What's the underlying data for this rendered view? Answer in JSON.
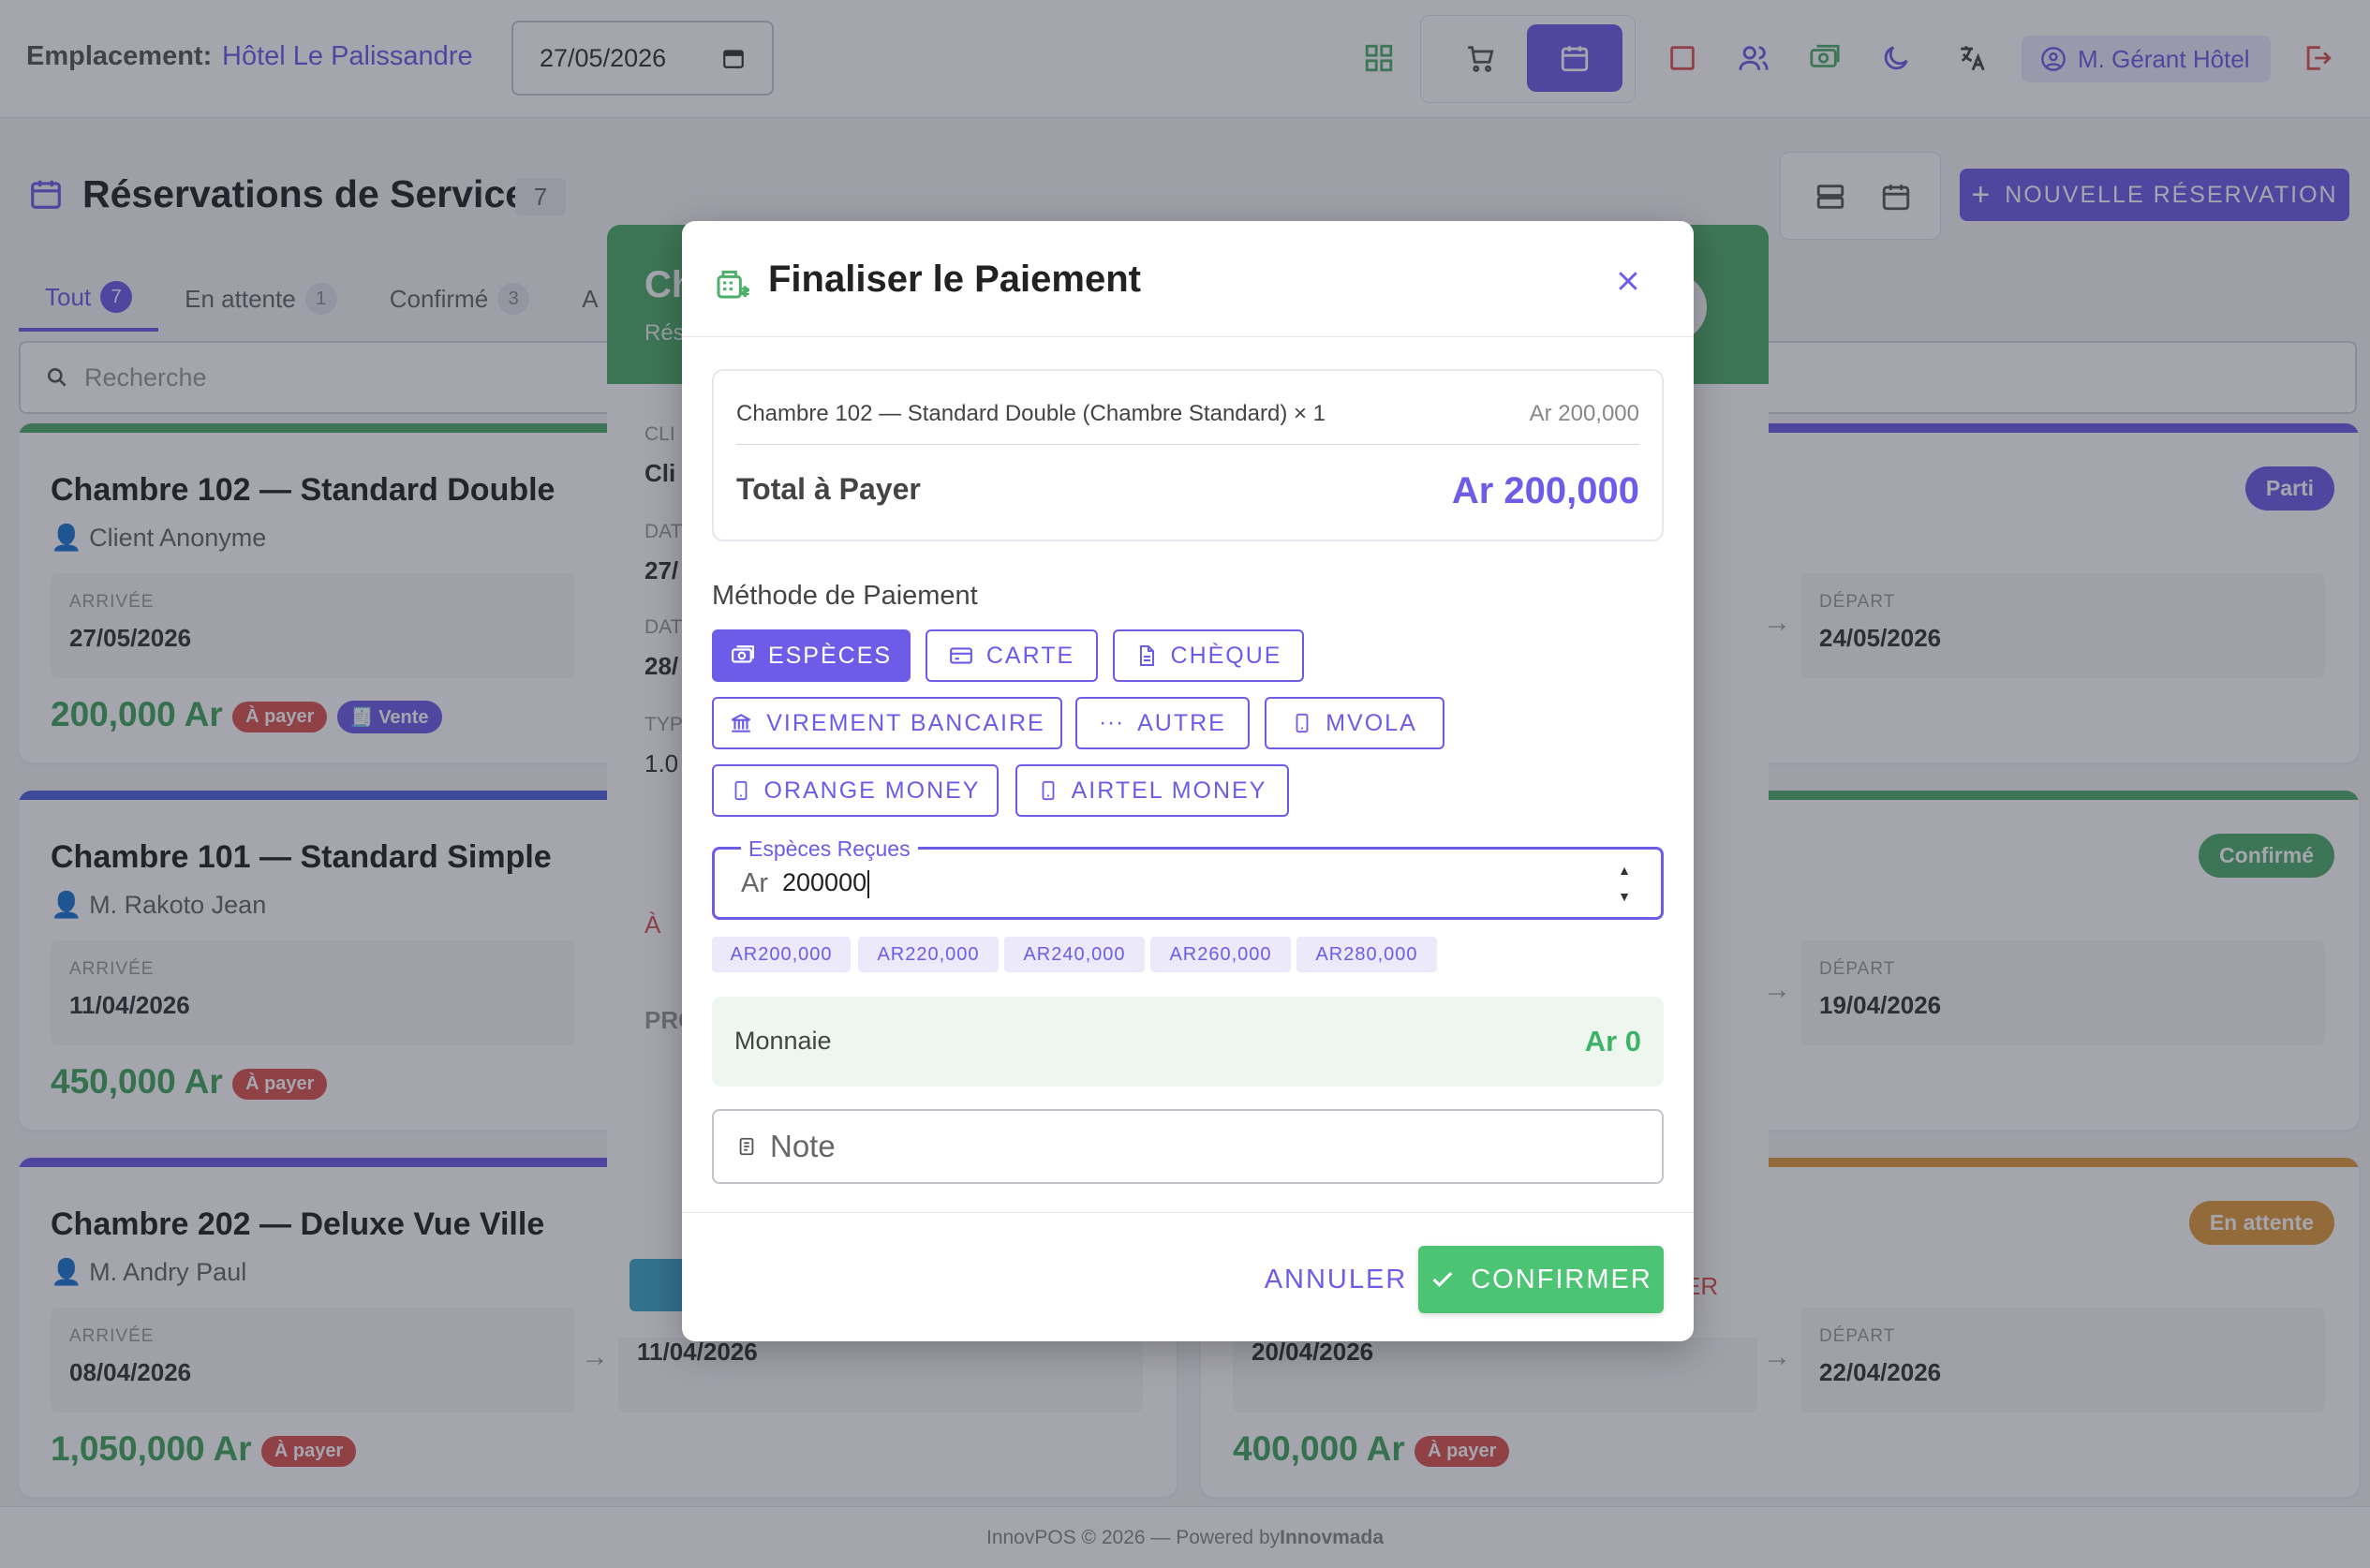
{
  "topbar": {
    "location_label": "Emplacement:",
    "location_value": "Hôtel Le Palissandre",
    "date_value": "27/05/2026",
    "user_name": "M. Gérant Hôtel"
  },
  "page": {
    "title": "Réservations de Service",
    "title_count": "7",
    "new_reservation_label": "NOUVELLE RÉSERVATION",
    "search_placeholder": "Recherche"
  },
  "tabs": [
    {
      "label": "Tout",
      "count": "7"
    },
    {
      "label": "En attente",
      "count": "1"
    },
    {
      "label": "Confirmé",
      "count": "3"
    },
    {
      "label": "A",
      "count": ""
    }
  ],
  "cards": [
    {
      "title": "Chambre 102 — Standard Double",
      "client": "Client Anonyme",
      "arrival_label": "ARRIVÉE",
      "arrival": "27/05/2026",
      "depart_label": "DÉPART",
      "depart": "24/05/2026",
      "price": "200,000 Ar",
      "badge_pay": "À payer",
      "badge_sale": "Vente",
      "status": "Parti",
      "status_color": "#6c5ce7",
      "bar_color": "#4caf6a"
    },
    {
      "title": "Chambre 101 — Standard Simple",
      "client": "M. Rakoto Jean",
      "arrival_label": "ARRIVÉE",
      "arrival": "11/04/2026",
      "depart_label": "DÉPART",
      "depart": "19/04/2026",
      "price": "450,000 Ar",
      "badge_pay": "À payer",
      "status": "Confirmé",
      "status_color": "#4caf6a",
      "bar_color": "#4a63d9"
    },
    {
      "title": "Chambre 202 — Deluxe Vue Ville",
      "client": "M. Andry Paul",
      "arrival_label": "ARRIVÉE",
      "arrival": "08/04/2026",
      "depart_label": "DÉPART",
      "depart": "11/04/2026",
      "price": "1,050,000 Ar",
      "badge_pay": "À payer",
      "bar_color": "#6c5ce7"
    },
    {
      "arrival": "20/04/2026",
      "depart_label": "DÉPART",
      "depart": "22/04/2026",
      "price": "400,000 Ar",
      "badge_pay": "À payer",
      "status": "En attente",
      "status_color": "#e09a3a",
      "bar_color": "#e09a3a"
    }
  ],
  "bg_dialog": {
    "title": "Ch",
    "subtitle": "Rés",
    "client_label": "CLI",
    "client_value": "Cli",
    "date1_label": "DAT",
    "date1_value": "27/",
    "date2_label": "DAT",
    "date2_value": "28/",
    "type_label": "TYP",
    "type_value": "1.0",
    "badge": "À",
    "section": "PRO",
    "right_btn": "ER"
  },
  "modal": {
    "title": "Finaliser le Paiement",
    "summary_line": "Chambre 102 — Standard Double (Chambre Standard) × 1",
    "summary_amount": "Ar 200,000",
    "total_label": "Total à Payer",
    "total_value": "Ar 200,000",
    "payment_method_label": "Méthode de Paiement",
    "methods": [
      "ESPÈCES",
      "CARTE",
      "CHÈQUE",
      "VIREMENT BANCAIRE",
      "AUTRE",
      "MVOLA",
      "ORANGE MONEY",
      "AIRTEL MONEY"
    ],
    "selected_method": "ESPÈCES",
    "cash_label": "Espèces Reçues",
    "cash_prefix": "Ar",
    "cash_value": "200000",
    "quick_amounts": [
      "AR200,000",
      "AR220,000",
      "AR240,000",
      "AR260,000",
      "AR280,000"
    ],
    "change_label": "Monnaie",
    "change_value": "Ar 0",
    "note_placeholder": "Note",
    "cancel_label": "ANNULER",
    "confirm_label": "CONFIRMER"
  },
  "footer": {
    "text": "InnovPOS © 2026 — Powered by",
    "brand": "Innovmada"
  },
  "colors": {
    "accent": "#6c5ce7",
    "success": "#4cc474",
    "danger": "#d9534f"
  }
}
